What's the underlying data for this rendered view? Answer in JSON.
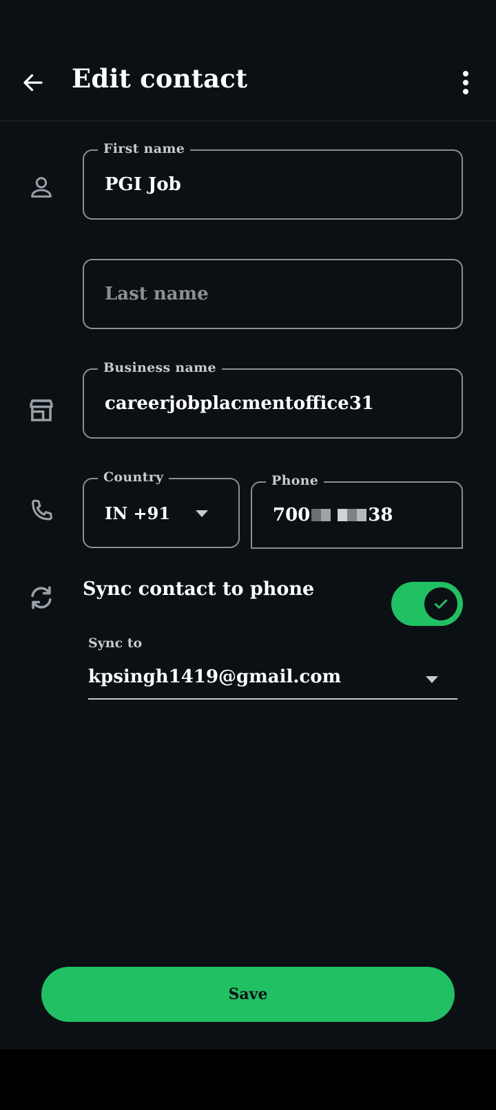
{
  "header": {
    "title": "Edit contact",
    "back_icon": "arrow-left-icon",
    "menu_icon": "more-vertical-icon"
  },
  "form": {
    "first_name": {
      "label": "First name",
      "value": "PGI Job",
      "icon": "person-icon"
    },
    "last_name": {
      "placeholder": "Last name",
      "value": ""
    },
    "business_name": {
      "label": "Business name",
      "value": "careerjobplacmentoffice31",
      "icon": "store-icon"
    },
    "country": {
      "label": "Country",
      "value": "IN +91"
    },
    "phone": {
      "label": "Phone",
      "value_prefix": "700",
      "value_suffix": "38",
      "icon": "phone-icon"
    }
  },
  "sync": {
    "label": "Sync contact to phone",
    "enabled": true,
    "icon": "sync-icon",
    "sync_to_label": "Sync to",
    "sync_to_value": "kpsingh1419@gmail.com"
  },
  "actions": {
    "save_label": "Save"
  },
  "colors": {
    "accent": "#21c063",
    "background": "#0b1014",
    "border": "#8a9196"
  }
}
